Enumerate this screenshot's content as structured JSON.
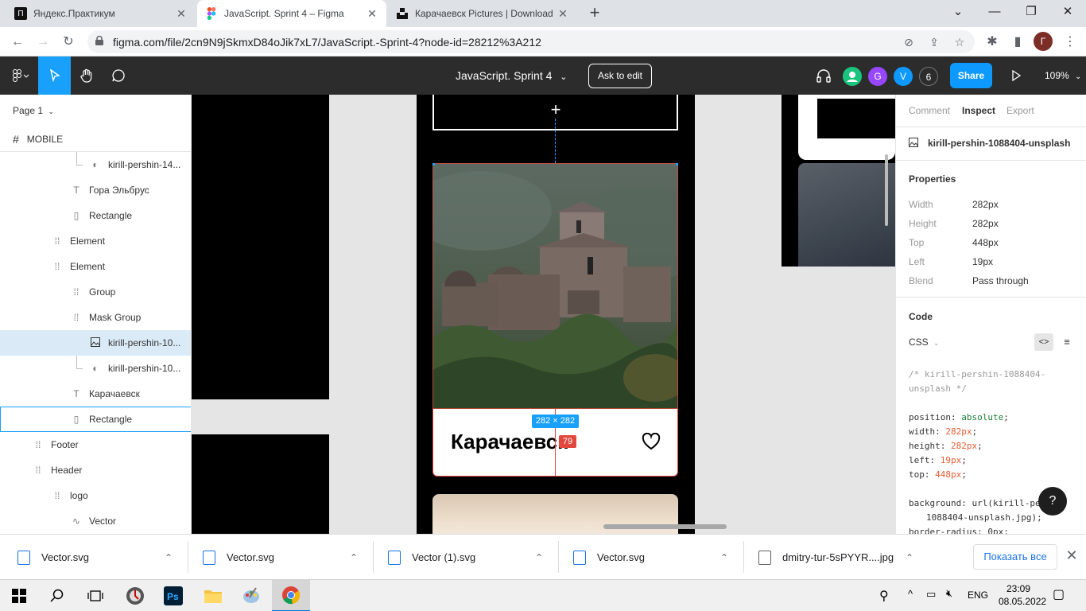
{
  "browser": {
    "tabs": [
      {
        "title": "Яндекс.Практикум",
        "favicon": "practicum-icon"
      },
      {
        "title": "JavaScript. Sprint 4 – Figma",
        "favicon": "figma-icon"
      },
      {
        "title": "Карачаевск Pictures | Download",
        "favicon": "unsplash-icon"
      }
    ],
    "url": "figma.com/file/2cn9N9jSkmxD84oJik7xL7/JavaScript.-Sprint-4?node-id=28212%3A212",
    "profile_initial": "Г"
  },
  "figma": {
    "doc_title": "JavaScript. Sprint 4",
    "ask_to_edit": "Ask to edit",
    "avatars": [
      {
        "letter": "",
        "color": "#1bc47d"
      },
      {
        "letter": "G",
        "color": "#9747ff"
      },
      {
        "letter": "V",
        "color": "#0d99ff"
      },
      {
        "letter": "6",
        "color": "#2c2c2c"
      }
    ],
    "share": "Share",
    "zoom": "109%"
  },
  "layers": {
    "page": "Page 1",
    "frame": "MOBILE",
    "items": [
      {
        "label": "kirill-pershin-14...",
        "icon": "mask-icon"
      },
      {
        "label": "Гора Эльбрус",
        "icon": "text-icon"
      },
      {
        "label": "Rectangle",
        "icon": "rectangle-icon"
      },
      {
        "label": "Element",
        "icon": "group-icon"
      },
      {
        "label": "Element",
        "icon": "group-icon"
      },
      {
        "label": "Group",
        "icon": "group-icon"
      },
      {
        "label": "Mask Group",
        "icon": "group-icon"
      },
      {
        "label": "kirill-pershin-10...",
        "icon": "image-icon"
      },
      {
        "label": "kirill-pershin-10...",
        "icon": "mask-icon"
      },
      {
        "label": "Карачаевск",
        "icon": "text-icon"
      },
      {
        "label": "Rectangle",
        "icon": "rectangle-icon"
      },
      {
        "label": "Footer",
        "icon": "group-icon"
      },
      {
        "label": "Header",
        "icon": "group-icon"
      },
      {
        "label": "logo",
        "icon": "group-icon"
      },
      {
        "label": "Vector",
        "icon": "vector-icon"
      }
    ]
  },
  "canvas": {
    "card_title": "Карачаевск",
    "size_badge": "282 × 282",
    "distance_badge": "79"
  },
  "inspect": {
    "tabs": [
      "Comment",
      "Inspect",
      "Export"
    ],
    "layer_name": "kirill-pershin-1088404-unsplash",
    "properties_title": "Properties",
    "properties": [
      {
        "key": "Width",
        "value": "282px"
      },
      {
        "key": "Height",
        "value": "282px"
      },
      {
        "key": "Top",
        "value": "448px"
      },
      {
        "key": "Left",
        "value": "19px"
      },
      {
        "key": "Blend",
        "value": "Pass through"
      }
    ],
    "code_title": "Code",
    "code_lang": "CSS",
    "code_comment_1": "/* kirill-pershin-1088404-",
    "code_comment_2": "unsplash */",
    "code_lines": [
      {
        "prop": "position: ",
        "val": "absolute",
        "kind": "kw"
      },
      {
        "prop": "width: ",
        "val": "282px",
        "kind": "num"
      },
      {
        "prop": "height: ",
        "val": "282px",
        "kind": "num"
      },
      {
        "prop": "left: ",
        "val": "19px",
        "kind": "num"
      },
      {
        "prop": "top: ",
        "val": "448px",
        "kind": "num"
      }
    ],
    "code_bg_1": "background: url(kirill-pe",
    "code_bg_2": "1088404-unsplash.jpg);",
    "code_radius": "border-radius: 0px;"
  },
  "downloads": {
    "items": [
      "Vector.svg",
      "Vector.svg",
      "Vector (1).svg",
      "Vector.svg",
      "dmitry-tur-5sPYYR....jpg"
    ],
    "show_all": "Показать все"
  },
  "taskbar": {
    "lang": "ENG",
    "time": "23:09",
    "date": "08.05.2022"
  }
}
